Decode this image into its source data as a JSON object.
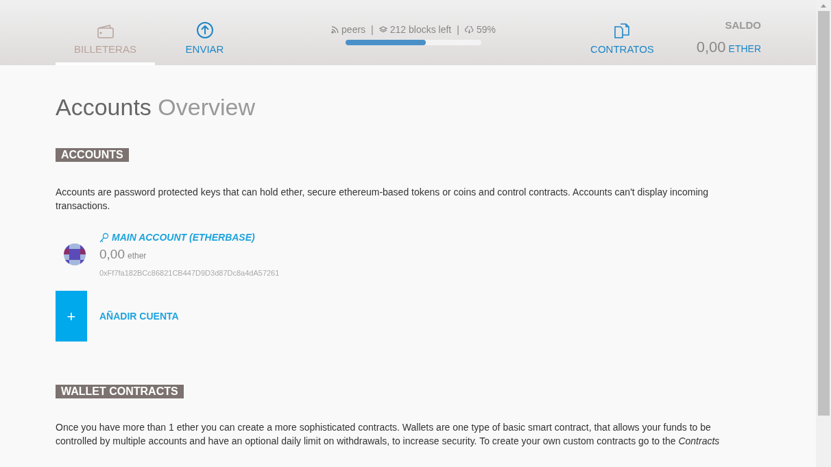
{
  "nav": {
    "tabs": [
      {
        "label": "BILLETERAS",
        "kind": "wallet",
        "selected": true
      },
      {
        "label": "ENVIAR",
        "kind": "send",
        "selected": false
      }
    ],
    "sync": {
      "separators": [
        "|",
        "|"
      ],
      "peers": "peers",
      "blocks": "212 blocks left",
      "percent": "59%",
      "level": 0.59
    },
    "right_tabs": [
      {
        "label": "CONTRATOS",
        "kind": "contracts",
        "selected": false
      }
    ],
    "balance": {
      "label": "SALDO",
      "amount": "0,00",
      "unit": "ETHER"
    }
  },
  "title": {
    "bold": "Accounts",
    "light": "Overview"
  },
  "accounts": {
    "heading": "ACCOUNTS",
    "description": "Accounts are password protected keys that can hold ether, secure ethereum-based tokens or coins and control contracts. Accounts can't display incoming transactions.",
    "items": [
      {
        "name": "MAIN ACCOUNT (ETHERBASE)",
        "amount": "0,00",
        "unit": "ether",
        "address": "0xFf7fa182BCc86821CB447D9D3d87Dc8a4dA57261"
      }
    ],
    "add": {
      "icon": "+",
      "label": "AÑADIR CUENTA"
    }
  },
  "wallet_contracts": {
    "heading": "WALLET CONTRACTS",
    "description": "Once you have more than 1 ether you can create a more sophisticated contracts. Wallets are one type of basic smart contract, that allows your funds to be controlled by multiple accounts and have an optional daily limit on withdrawals, to increase security. To create your own custom contracts go to the *Contracts*"
  }
}
